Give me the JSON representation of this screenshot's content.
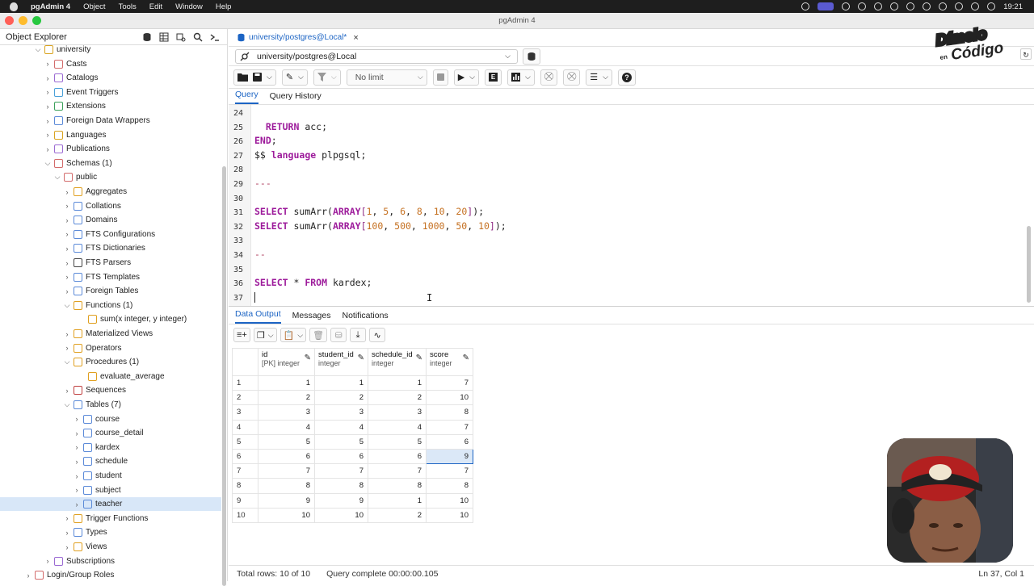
{
  "menubar": {
    "app": "pgAdmin 4",
    "items": [
      "Object",
      "Tools",
      "Edit",
      "Window",
      "Help"
    ],
    "time": "19:21"
  },
  "window": {
    "title": "pgAdmin 4"
  },
  "explorer": {
    "title": "Object Explorer",
    "nodes": [
      {
        "label": "university",
        "arrow": "v"
      },
      {
        "label": "Casts",
        "arrow": ">"
      },
      {
        "label": "Catalogs",
        "arrow": ">"
      },
      {
        "label": "Event Triggers",
        "arrow": ">"
      },
      {
        "label": "Extensions",
        "arrow": ">"
      },
      {
        "label": "Foreign Data Wrappers",
        "arrow": ">"
      },
      {
        "label": "Languages",
        "arrow": ">"
      },
      {
        "label": "Publications",
        "arrow": ">"
      },
      {
        "label": "Schemas (1)",
        "arrow": "v"
      },
      {
        "label": "public",
        "arrow": "v"
      },
      {
        "label": "Aggregates",
        "arrow": ">"
      },
      {
        "label": "Collations",
        "arrow": ">"
      },
      {
        "label": "Domains",
        "arrow": ">"
      },
      {
        "label": "FTS Configurations",
        "arrow": ">"
      },
      {
        "label": "FTS Dictionaries",
        "arrow": ">"
      },
      {
        "label": "FTS Parsers",
        "arrow": ">"
      },
      {
        "label": "FTS Templates",
        "arrow": ">"
      },
      {
        "label": "Foreign Tables",
        "arrow": ">"
      },
      {
        "label": "Functions (1)",
        "arrow": "v"
      },
      {
        "label": "sum(x integer, y integer)",
        "arrow": ""
      },
      {
        "label": "Materialized Views",
        "arrow": ">"
      },
      {
        "label": "Operators",
        "arrow": ">"
      },
      {
        "label": "Procedures (1)",
        "arrow": "v"
      },
      {
        "label": "evaluate_average",
        "arrow": ""
      },
      {
        "label": "Sequences",
        "arrow": ">"
      },
      {
        "label": "Tables (7)",
        "arrow": "v"
      },
      {
        "label": "course",
        "arrow": ">"
      },
      {
        "label": "course_detail",
        "arrow": ">"
      },
      {
        "label": "kardex",
        "arrow": ">"
      },
      {
        "label": "schedule",
        "arrow": ">"
      },
      {
        "label": "student",
        "arrow": ">"
      },
      {
        "label": "subject",
        "arrow": ">"
      },
      {
        "label": "teacher",
        "arrow": ">"
      },
      {
        "label": "Trigger Functions",
        "arrow": ">"
      },
      {
        "label": "Types",
        "arrow": ">"
      },
      {
        "label": "Views",
        "arrow": ">"
      },
      {
        "label": "Subscriptions",
        "arrow": ">"
      },
      {
        "label": "Login/Group Roles",
        "arrow": ">"
      }
    ]
  },
  "query_tab": {
    "label": "university/postgres@Local*",
    "close": "×"
  },
  "connection": {
    "value": "university/postgres@Local"
  },
  "toolbar": {
    "limit": "No limit"
  },
  "editor_tabs": [
    "Query",
    "Query History"
  ],
  "code_lines": [
    {
      "n": "24",
      "html": ""
    },
    {
      "n": "25",
      "html": "  <span class=\"kw\">RETURN</span> acc;"
    },
    {
      "n": "26",
      "html": "<span class=\"kw\">END</span>;"
    },
    {
      "n": "27",
      "html": "$$ <span class=\"kw\">language</span> plpgsql;"
    },
    {
      "n": "28",
      "html": ""
    },
    {
      "n": "29",
      "html": "<span class=\"cmt\">---</span>"
    },
    {
      "n": "30",
      "html": ""
    },
    {
      "n": "31",
      "html": "<span class=\"kw\">SELECT</span> sumArr(<span class=\"kw\">ARRAY</span><span class=\"grey\">[</span><span class=\"num\">1</span>, <span class=\"num\">5</span>, <span class=\"num\">6</span>, <span class=\"num\">8</span>, <span class=\"num\">10</span>, <span class=\"num\">20</span><span class=\"grey\">]</span>);"
    },
    {
      "n": "32",
      "html": "<span class=\"kw\">SELECT</span> sumArr(<span class=\"kw\">ARRAY</span><span class=\"grey\">[</span><span class=\"num\">100</span>, <span class=\"num\">500</span>, <span class=\"num\">1000</span>, <span class=\"num\">50</span>, <span class=\"num\">10</span><span class=\"grey\">]</span>);"
    },
    {
      "n": "33",
      "html": ""
    },
    {
      "n": "34",
      "html": "<span class=\"cmt\">--</span>"
    },
    {
      "n": "35",
      "html": ""
    },
    {
      "n": "36",
      "html": "<span class=\"kw\">SELECT</span> * <span class=\"kw\">FROM</span> kardex;"
    },
    {
      "n": "37",
      "html": "<span class=\"caret\"></span>"
    }
  ],
  "output_tabs": [
    "Data Output",
    "Messages",
    "Notifications"
  ],
  "grid": {
    "columns": [
      {
        "name": "id",
        "type": "[PK] integer"
      },
      {
        "name": "student_id",
        "type": "integer"
      },
      {
        "name": "schedule_id",
        "type": "integer"
      },
      {
        "name": "score",
        "type": "integer"
      }
    ],
    "rows": [
      [
        "1",
        "1",
        "1",
        "1",
        "7"
      ],
      [
        "2",
        "2",
        "2",
        "2",
        "10"
      ],
      [
        "3",
        "3",
        "3",
        "3",
        "8"
      ],
      [
        "4",
        "4",
        "4",
        "4",
        "7"
      ],
      [
        "5",
        "5",
        "5",
        "5",
        "6"
      ],
      [
        "6",
        "6",
        "6",
        "6",
        "9"
      ],
      [
        "7",
        "7",
        "7",
        "7",
        "7"
      ],
      [
        "8",
        "8",
        "8",
        "8",
        "8"
      ],
      [
        "9",
        "9",
        "9",
        "1",
        "10"
      ],
      [
        "10",
        "10",
        "10",
        "2",
        "10"
      ]
    ]
  },
  "status": {
    "rows": "Total rows: 10 of 10",
    "query": "Query complete 00:00:00.105",
    "position": "Ln 37, Col 1"
  },
  "logo": {
    "line1": "Dímelo",
    "line2": "Código",
    "small": "en"
  }
}
